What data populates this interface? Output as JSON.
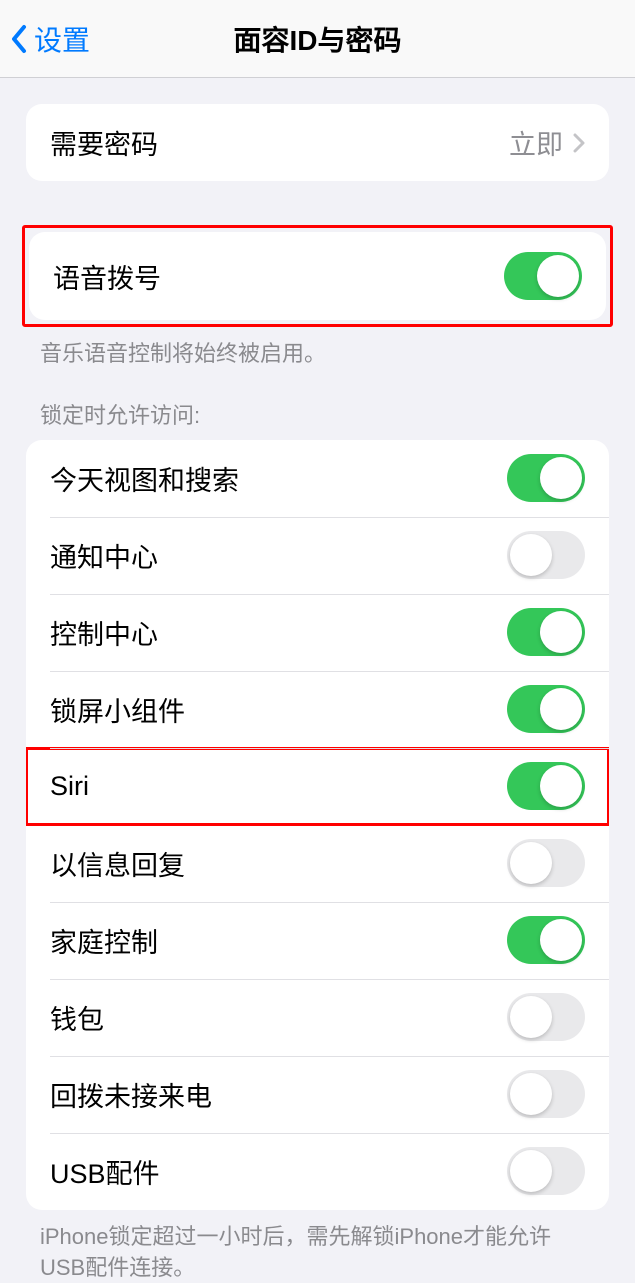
{
  "nav": {
    "back_label": "设置",
    "title": "面容ID与密码"
  },
  "require_passcode": {
    "label": "需要密码",
    "value": "立即"
  },
  "voice_dial": {
    "label": "语音拨号",
    "footer": "音乐语音控制将始终被启用。"
  },
  "lock_access": {
    "header": "锁定时允许访问:",
    "items": [
      {
        "label": "今天视图和搜索",
        "on": true
      },
      {
        "label": "通知中心",
        "on": false
      },
      {
        "label": "控制中心",
        "on": true
      },
      {
        "label": "锁屏小组件",
        "on": true
      },
      {
        "label": "Siri",
        "on": true
      },
      {
        "label": "以信息回复",
        "on": false
      },
      {
        "label": "家庭控制",
        "on": true
      },
      {
        "label": "钱包",
        "on": false
      },
      {
        "label": "回拨未接来电",
        "on": false
      },
      {
        "label": "USB配件",
        "on": false
      }
    ],
    "footer": "iPhone锁定超过一小时后，需先解锁iPhone才能允许USB配件连接。"
  },
  "highlights": {
    "voice_dial": true,
    "siri_index": 4
  }
}
